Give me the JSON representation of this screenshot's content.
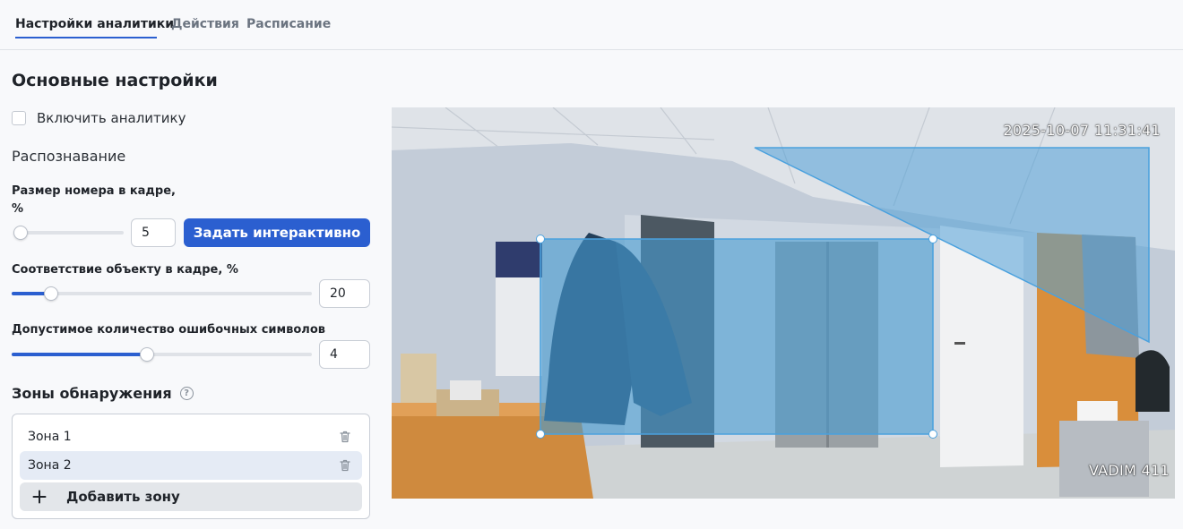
{
  "tabs": [
    {
      "label": "Настройки аналитики",
      "active": true
    },
    {
      "label": "Действия",
      "active": false
    },
    {
      "label": "Расписание",
      "active": false
    }
  ],
  "main": {
    "title": "Основные настройки",
    "enable_label": "Включить аналитику",
    "enable_checked": false,
    "recognition_title": "Распознавание",
    "plate_size": {
      "label_line1": "Размер номера в кадре,",
      "label_line2": "%",
      "value": "5",
      "slider_fraction": 0.05
    },
    "set_interactive_button": "Задать интерактивно",
    "object_match": {
      "label": "Соответствие объекту в кадре, %",
      "value": "20",
      "slider_fraction": 0.13
    },
    "allowed_errors": {
      "label": "Допустимое количество ошибочных символов",
      "value": "4",
      "slider_fraction": 0.45
    },
    "zones_title": "Зоны обнаружения",
    "zones": [
      {
        "label": "Зона 1",
        "selected": false
      },
      {
        "label": "Зона 2",
        "selected": true
      }
    ],
    "add_zone_label": "Добавить зону"
  },
  "camera": {
    "timestamp": "2025-10-07 11:31:41",
    "name": "VADIM 411"
  },
  "icons": {
    "help": "question-circle-icon",
    "trash": "trash-icon",
    "plus": "plus-icon"
  },
  "colors": {
    "accent": "#2b5fd0",
    "zone_fill": "#5aa7dc"
  }
}
